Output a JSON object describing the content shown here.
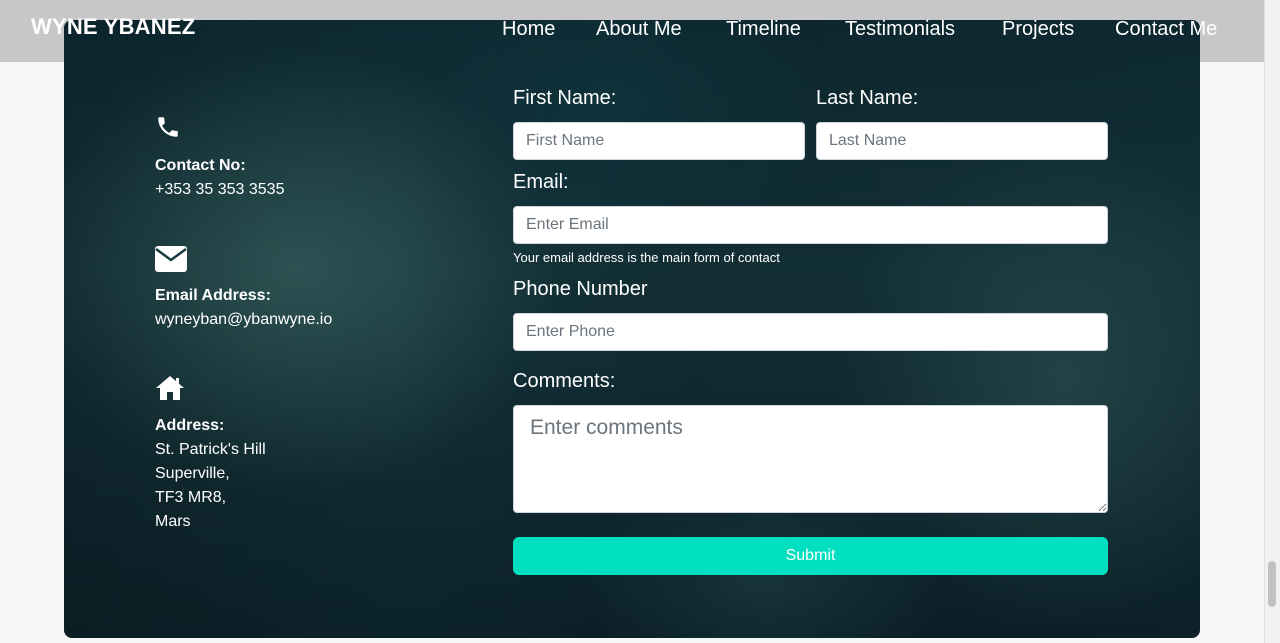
{
  "brand": "WYNE YBANEZ",
  "nav": {
    "items": [
      "Home",
      "About Me",
      "Timeline",
      "Testimonials",
      "Projects",
      "Contact Me"
    ]
  },
  "contact_info": {
    "phone": {
      "icon": "phone-icon",
      "label": "Contact No:",
      "value": "+353 35 353 3535"
    },
    "email": {
      "icon": "envelope-icon",
      "label": "Email Address:",
      "value": "wyneyban@ybanwyne.io"
    },
    "address": {
      "icon": "home-icon",
      "label": "Address:",
      "lines": [
        "St. Patrick's Hill",
        "Superville,",
        "TF3 MR8,",
        "Mars"
      ]
    }
  },
  "form": {
    "first_name": {
      "label": "First Name:",
      "placeholder": "First Name",
      "value": ""
    },
    "last_name": {
      "label": "Last Name:",
      "placeholder": "Last Name",
      "value": ""
    },
    "email": {
      "label": "Email:",
      "placeholder": "Enter Email",
      "value": "",
      "help": "Your email address is the main form of contact"
    },
    "phone": {
      "label": "Phone Number",
      "placeholder": "Enter Phone",
      "value": ""
    },
    "comments": {
      "label": "Comments:",
      "placeholder": "Enter comments",
      "value": ""
    },
    "submit_label": "Submit"
  },
  "colors": {
    "accent": "#00dfc0",
    "header_bg": "#c7c7c9",
    "text_on_dark": "#ffffff"
  }
}
